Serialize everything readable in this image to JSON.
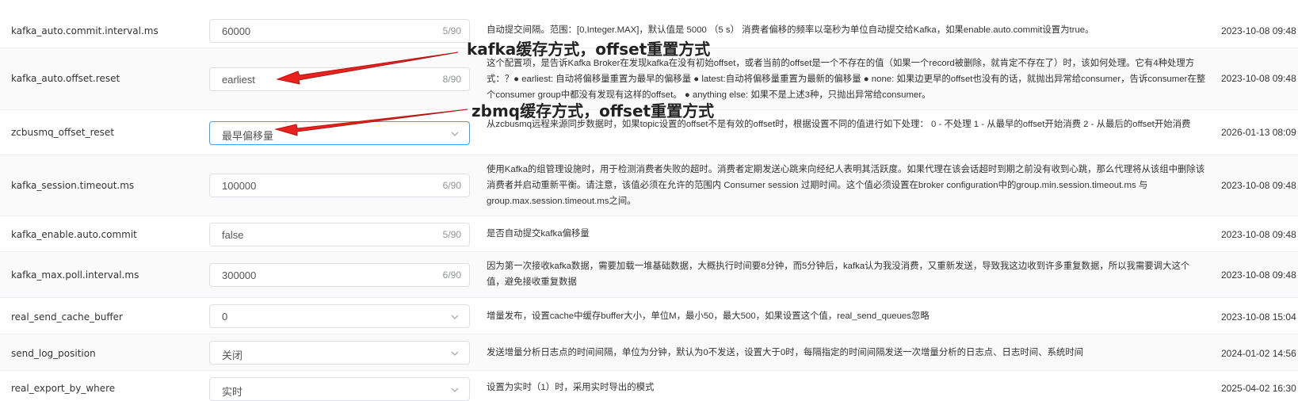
{
  "rows": [
    {
      "param": "kafka_auto.commit.interval.ms",
      "value": "60000",
      "count": "5/90",
      "desc": "自动提交间隔。范围：[0,Integer.MAX]，默认值是 5000 （5 s） 消费者偏移的频率以毫秒为单位自动提交给Kafka，如果enable.auto.commit设置为true。",
      "date": "2023-10-08 09:48"
    },
    {
      "param": "kafka_auto.offset.reset",
      "value": "earliest",
      "count": "8/90",
      "desc": "这个配置项，是告诉Kafka Broker在发现kafka在没有初始offset，或者当前的offset是一个不存在的值（如果一个record被删除，就肯定不存在了）时，该如何处理。它有4种处理方式：？● earliest: 自动将偏移量重置为最早的偏移量 ● latest:自动将偏移量重置为最新的偏移量 ● none: 如果边更早的offset也没有的话，就抛出异常给consumer，告诉consumer在整个consumer group中都没有发现有这样的offset。 ● anything else: 如果不是上述3种，只抛出异常给consumer。",
      "date": "2023-10-08 09:48"
    },
    {
      "param": "zcbusmq_offset_reset",
      "value": "最早偏移量",
      "desc": "从zcbusmq远程来源同步数据时，如果topic设置的offset不是有效的offset时，根据设置不同的值进行如下处理： 0 - 不处理 1 - 从最早的offset开始消费 2 - 从最后的offset开始消费",
      "date": "2026-01-13 08:09"
    },
    {
      "param": "kafka_session.timeout.ms",
      "value": "100000",
      "count": "6/90",
      "desc": "使用Kafka的组管理设施时，用于检测消费者失败的超时。消费者定期发送心跳来向经纪人表明其活跃度。如果代理在该会话超时到期之前没有收到心跳，那么代理将从该组中删除该消费者并启动重新平衡。请注意，该值必须在允许的范围内 Consumer session 过期时间。这个值必须设置在broker configuration中的group.min.session.timeout.ms 与 group.max.session.timeout.ms之间。",
      "date": "2023-10-08 09:48"
    },
    {
      "param": "kafka_enable.auto.commit",
      "value": "false",
      "count": "5/90",
      "desc": "是否自动提交kafka偏移量",
      "date": "2023-10-08 09:48"
    },
    {
      "param": "kafka_max.poll.interval.ms",
      "value": "300000",
      "count": "6/90",
      "desc": "因为第一次接收kafka数据，需要加载一堆基础数据，大概执行时间要8分钟，而5分钟后，kafka认为我没消费，又重新发送，导致我这边收到许多重复数据，所以我需要调大这个值，避免接收重复数据",
      "date": "2023-10-08 09:48"
    },
    {
      "param": "real_send_cache_buffer",
      "value": "0",
      "desc": "增量发布，设置cache中缓存buffer大小，单位M，最小50，最大500，如果设置这个值，real_send_queues忽略",
      "date": "2023-10-08 15:04"
    },
    {
      "param": "send_log_position",
      "value": "关闭",
      "desc": "发送增量分析日志点的时间间隔，单位为分钟，默认为0不发送，设置大于0时，每隔指定的时间间隔发送一次增量分析的日志点、日志时间、系统时间",
      "date": "2024-01-02 14:56"
    },
    {
      "param": "real_export_by_where",
      "value": "实时",
      "desc": "设置为实时（1）时，采用实时导出的模式",
      "date": "2025-04-02 16:30"
    }
  ],
  "annotations": [
    {
      "text": "kafka缓存方式，offset重置方式"
    },
    {
      "text": "zbmq缓存方式，offset重置方式"
    }
  ],
  "colors": {
    "arrow": "#e8221f",
    "focus": "#409eff",
    "border": "#dcdfe6"
  },
  "icons": {
    "select": "chevron-down-icon"
  }
}
